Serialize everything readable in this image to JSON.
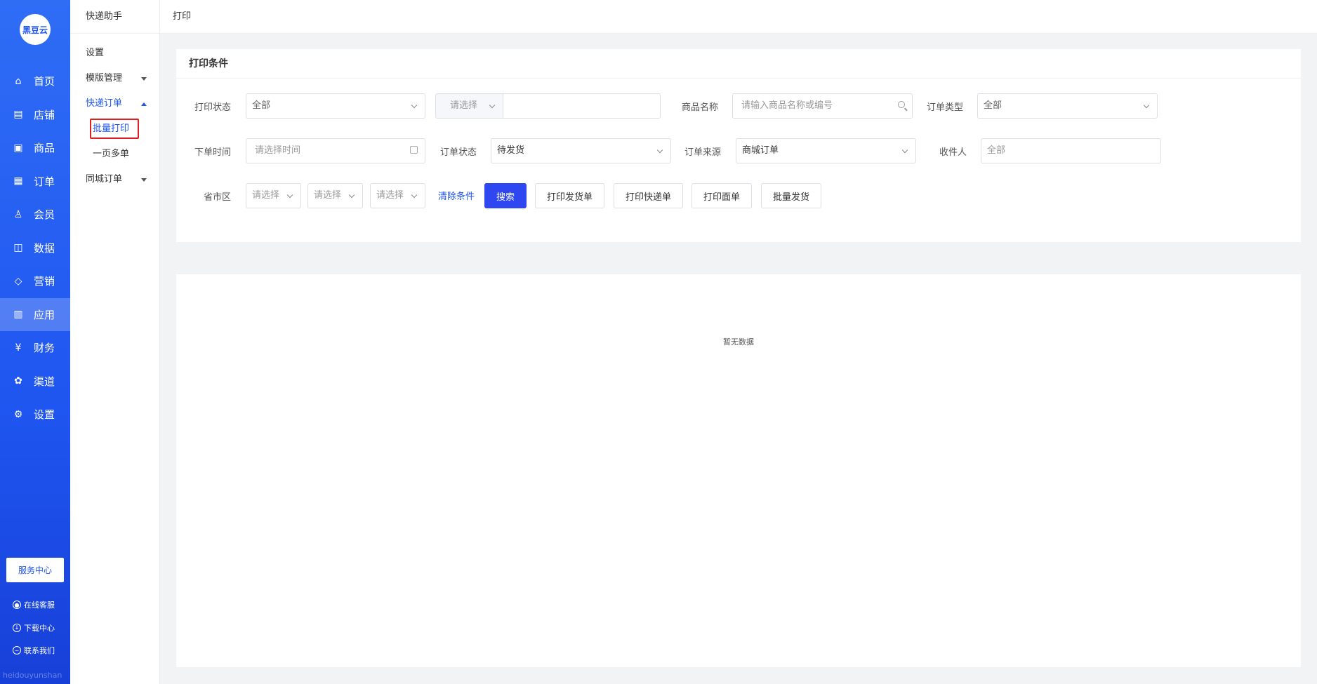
{
  "brand": {
    "logo_text": "黑豆云",
    "watermark": "heidouyunshan"
  },
  "nav": {
    "items": [
      {
        "label": "首页",
        "icon": "home-icon",
        "glyph": "⌂"
      },
      {
        "label": "店铺",
        "icon": "store-icon",
        "glyph": "▤"
      },
      {
        "label": "商品",
        "icon": "goods-icon",
        "glyph": "▣"
      },
      {
        "label": "订单",
        "icon": "order-icon",
        "glyph": "▦"
      },
      {
        "label": "会员",
        "icon": "member-icon",
        "glyph": "♙"
      },
      {
        "label": "数据",
        "icon": "data-icon",
        "glyph": "◫"
      },
      {
        "label": "营销",
        "icon": "tag-icon",
        "glyph": "◇"
      },
      {
        "label": "应用",
        "icon": "app-icon",
        "glyph": "▥"
      },
      {
        "label": "财务",
        "icon": "finance-icon",
        "glyph": "¥"
      },
      {
        "label": "渠道",
        "icon": "channel-icon",
        "glyph": "✿"
      },
      {
        "label": "设置",
        "icon": "settings-icon",
        "glyph": "⚙"
      }
    ],
    "active_index": 7,
    "service_center": "服务中心",
    "bottom_links": [
      {
        "label": "在线客服",
        "icon": "customer-service-icon"
      },
      {
        "label": "下载中心",
        "icon": "download-icon"
      },
      {
        "label": "联系我们",
        "icon": "contact-icon"
      }
    ]
  },
  "submenu": {
    "title": "快递助手",
    "items": {
      "settings": "设置",
      "template": "模版管理",
      "express_order": "快递订单",
      "batch_print": "批量打印",
      "one_page_multi": "一页多单",
      "local_order": "同城订单"
    }
  },
  "breadcrumb": "打印",
  "filter": {
    "title": "打印条件",
    "print_status": {
      "label": "打印状态",
      "value": "全部"
    },
    "combo": {
      "select": "请选择",
      "input": ""
    },
    "goods_name": {
      "label": "商品名称",
      "placeholder": "请输入商品名称或编号"
    },
    "order_type": {
      "label": "订单类型",
      "value": "全部"
    },
    "order_time": {
      "label": "下单时间",
      "placeholder": "请选择时间"
    },
    "order_status": {
      "label": "订单状态",
      "value": "待发货"
    },
    "order_source": {
      "label": "订单来源",
      "value": "商城订单"
    },
    "receiver": {
      "label": "收件人",
      "placeholder": "全部"
    },
    "region": {
      "label": "省市区",
      "province": "请选择",
      "city": "请选择",
      "district": "请选择"
    },
    "clear": "清除条件",
    "buttons": {
      "search": "搜索",
      "print_invoice": "打印发货单",
      "print_express": "打印快递单",
      "print_waybill": "打印面单",
      "batch_ship": "批量发货"
    }
  },
  "table": {
    "empty_text": "暂无数据"
  }
}
